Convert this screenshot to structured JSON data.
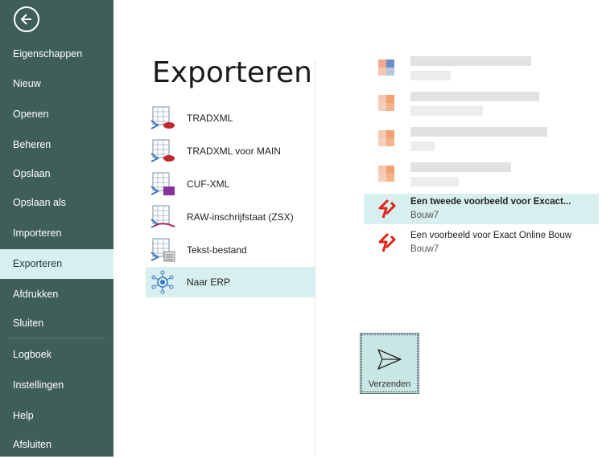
{
  "sidebar": {
    "back_icon": "arrow-left-icon",
    "items": [
      {
        "label": "Eigenschappen"
      },
      {
        "label": "Nieuw"
      },
      {
        "label": "Openen"
      },
      {
        "label": "Beheren"
      },
      {
        "label": "Opslaan"
      },
      {
        "label": "Opslaan als"
      },
      {
        "label": "Importeren"
      },
      {
        "label": "Exporteren",
        "active": true
      },
      {
        "label": "Afdrukken"
      },
      {
        "label": "Sluiten"
      },
      {
        "label": "Logboek"
      },
      {
        "label": "Instellingen"
      },
      {
        "label": "Help"
      },
      {
        "label": "Afsluiten"
      }
    ]
  },
  "page": {
    "title": "Exporteren"
  },
  "export_options": [
    {
      "label": "TRADXML",
      "icon": "tradxml-icon"
    },
    {
      "label": "TRADXML voor MAIN",
      "icon": "tradxml-main-icon"
    },
    {
      "label": "CUF-XML",
      "icon": "cuf-xml-icon"
    },
    {
      "label": "RAW-inschrijfstaat (ZSX)",
      "icon": "raw-icon"
    },
    {
      "label": "Tekst-bestand",
      "icon": "text-file-icon"
    },
    {
      "label": "Naar ERP",
      "icon": "erp-network-icon",
      "active": true
    }
  ],
  "erp_connections": [
    {
      "title": "Een tweede voorbeeld voor Excact...",
      "subtitle": "Bouw7",
      "selected": true
    },
    {
      "title": "Een voorbeeld voor Exact Online Bouw",
      "subtitle": "Bouw7",
      "selected": false
    }
  ],
  "send_button": {
    "label": "Verzenden",
    "icon": "send-icon"
  },
  "colors": {
    "sidebar": "#3f5e58",
    "active_bg": "#d8efef",
    "exact_red": "#e2231a"
  }
}
